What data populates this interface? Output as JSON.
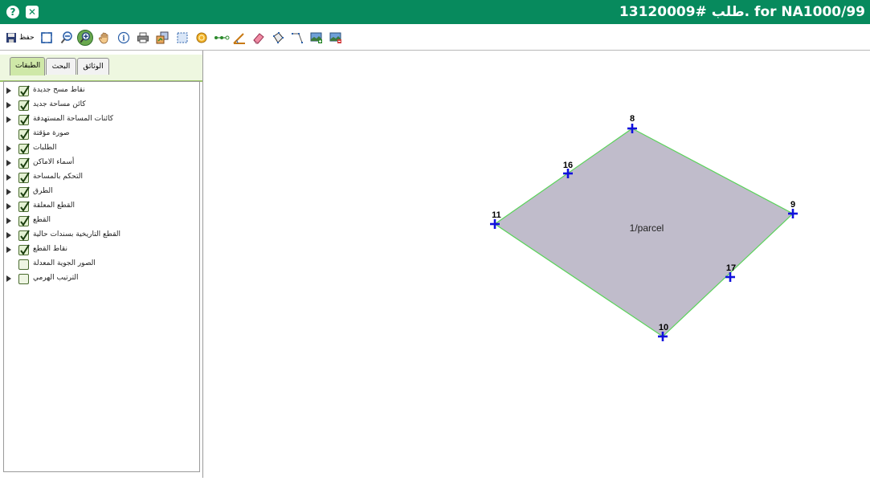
{
  "title_bar": {
    "title": "13120009# طلب. for NA1000/99",
    "help_icon": "question-mark-icon",
    "close_icon": "close-icon",
    "background_color": "#078a5d"
  },
  "toolbar": {
    "save_label": "حفظ",
    "tools": [
      "save-icon",
      "zoom-extent-icon",
      "zoom-out-icon",
      "zoom-in-icon",
      "pan-hand-icon",
      "info-icon",
      "print-icon",
      "layers-export-icon",
      "select-rectangle-icon",
      "coin-icon",
      "measure-line-icon",
      "measure-angle-icon",
      "eraser-icon",
      "polygon-icon",
      "polyline-icon",
      "add-image-icon",
      "remove-image-icon"
    ],
    "active_tool": "zoom-in-icon"
  },
  "left_panel": {
    "tabs": [
      {
        "label": "الطبقات",
        "active": true
      },
      {
        "label": "البحث",
        "active": false
      },
      {
        "label": "الوثائق",
        "active": false
      }
    ],
    "layers": [
      {
        "label": "نقاط مسح جديدة",
        "checked": true,
        "expandable": true
      },
      {
        "label": "كائن مساحة جديد",
        "checked": true,
        "expandable": true
      },
      {
        "label": "كائنات المساحة المستهدفة",
        "checked": true,
        "expandable": true
      },
      {
        "label": "صورة مؤقتة",
        "checked": true,
        "expandable": false
      },
      {
        "label": "الطلبات",
        "checked": true,
        "expandable": true
      },
      {
        "label": "أسماء الاماكن",
        "checked": true,
        "expandable": true
      },
      {
        "label": "التحكم بالمساحة",
        "checked": true,
        "expandable": true
      },
      {
        "label": "الطرق",
        "checked": true,
        "expandable": true
      },
      {
        "label": "القطع المعلقة",
        "checked": true,
        "expandable": true
      },
      {
        "label": "القطع",
        "checked": true,
        "expandable": true
      },
      {
        "label": "القطع التاريخية بسندات حالية",
        "checked": true,
        "expandable": true
      },
      {
        "label": "نقاط القطع",
        "checked": true,
        "expandable": true
      },
      {
        "label": "الصور الجوية المعدلة",
        "checked": false,
        "expandable": false
      },
      {
        "label": "الترتيب الهرمي",
        "checked": false,
        "expandable": true
      }
    ]
  },
  "map": {
    "parcel_label": "1/parcel",
    "parcel_fill": "#c0bccb",
    "parcel_stroke": "#5ad35a",
    "point_color": "#1111dd",
    "points": [
      {
        "id": "8",
        "label": "8"
      },
      {
        "id": "16",
        "label": "16"
      },
      {
        "id": "9",
        "label": "9"
      },
      {
        "id": "11",
        "label": "11"
      },
      {
        "id": "17",
        "label": "17"
      },
      {
        "id": "10",
        "label": "10"
      }
    ]
  }
}
